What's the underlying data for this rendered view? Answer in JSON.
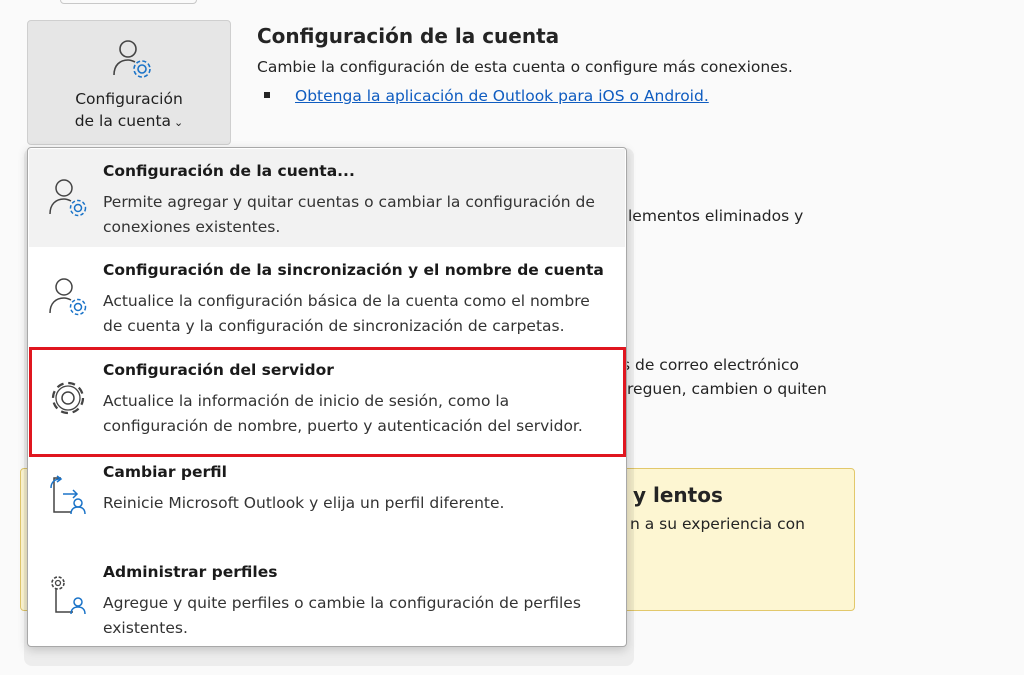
{
  "account_button": {
    "label_line1": "Configuración",
    "label_line2": "de la cuenta",
    "chevron": "⌄",
    "icon": "person-gear-icon"
  },
  "section": {
    "title": "Configuración de la cuenta",
    "description": "Cambie la configuración de esta cuenta o configure más conexiones.",
    "link": "Obtenga la aplicación de Outlook para iOS o Android."
  },
  "background_fragments": {
    "line1": "lementos eliminados y",
    "line2": "s de correo electrónico",
    "line3": "reguen, cambien o quiten"
  },
  "slow_box": {
    "title": "y lentos",
    "desc": "n a su experiencia con"
  },
  "menu": {
    "items": [
      {
        "title": "Configuración de la cuenta...",
        "desc": "Permite agregar y quitar cuentas o cambiar la configuración de conexiones existentes.",
        "icon": "person-gear-icon"
      },
      {
        "title": "Configuración de la sincronización y el nombre de cuenta",
        "desc": "Actualice la configuración básica de la cuenta como el nombre de cuenta y la configuración de sincronización de carpetas.",
        "icon": "person-gear-icon"
      },
      {
        "title": "Configuración del servidor",
        "desc": "Actualice la información de inicio de sesión, como la configuración de nombre, puerto y autenticación del servidor.",
        "icon": "gear-icon"
      },
      {
        "title": "Cambiar perfil",
        "desc": "Reinicie Microsoft Outlook y elija un perfil diferente.",
        "icon": "switch-profile-icon"
      },
      {
        "title": "Administrar perfiles",
        "desc": "Agregue y quite perfiles o cambie la configuración de perfiles existentes.",
        "icon": "manage-profiles-icon"
      }
    ]
  },
  "colors": {
    "link": "#0f5cc0",
    "highlight_border": "#e0161f",
    "icon_blue": "#1a73c8"
  }
}
